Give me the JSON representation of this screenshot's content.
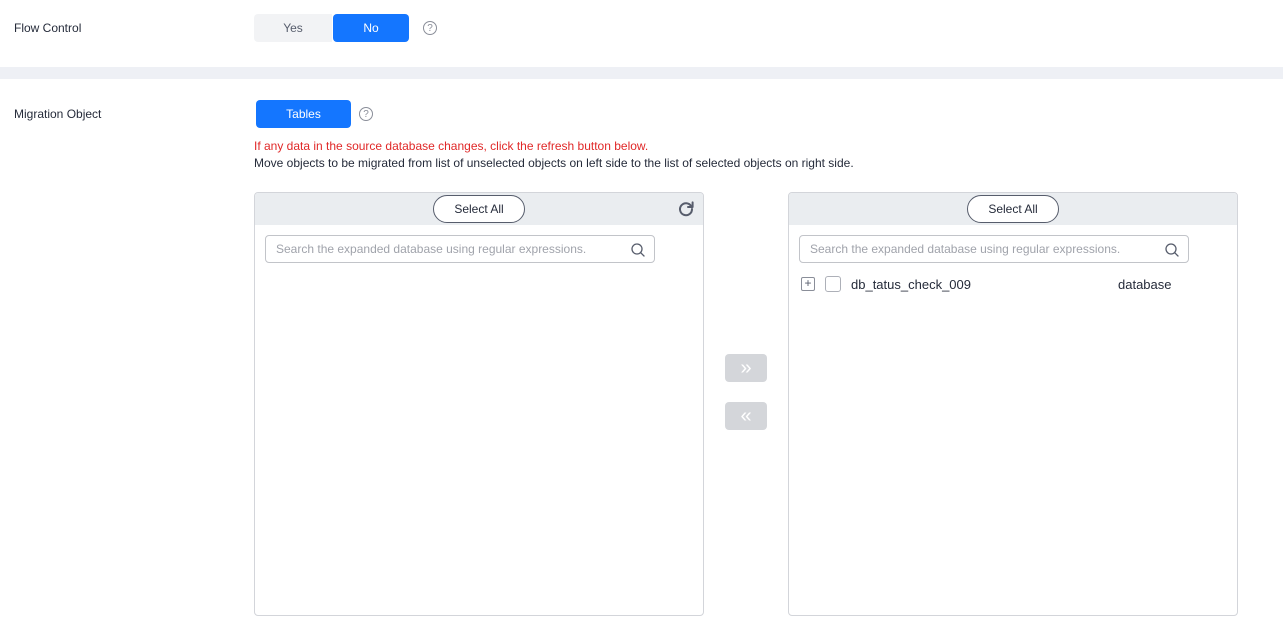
{
  "flow_control": {
    "label": "Flow Control",
    "options": [
      "Yes",
      "No"
    ],
    "selected": "No",
    "help_icon": "question-circle-icon"
  },
  "migration_object": {
    "label": "Migration Object",
    "mode_button": "Tables",
    "help_icon": "question-circle-icon",
    "warning": "If any data in the source database changes, click the refresh button below.",
    "description": "Move objects to be migrated from list of unselected objects on left side to the list of selected objects on right side."
  },
  "left_panel": {
    "select_all": "Select All",
    "refresh_icon": "refresh-icon",
    "search_placeholder": "Search the expanded database using regular expressions.",
    "items": []
  },
  "right_panel": {
    "select_all": "Select All",
    "search_placeholder": "Search the expanded database using regular expressions.",
    "items": [
      {
        "name": "db_tatus_check_009",
        "type": "database",
        "checked": false,
        "expanded": false
      }
    ]
  },
  "transfer": {
    "move_right_icon": "double-chevron-right-icon",
    "move_left_icon": "double-chevron-left-icon",
    "move_right_glyph": "»",
    "move_left_glyph": "«"
  },
  "colors": {
    "primary": "#1476ff",
    "warning": "#e02828",
    "divider": "#eef0f5",
    "disabled": "#d4d6da"
  }
}
